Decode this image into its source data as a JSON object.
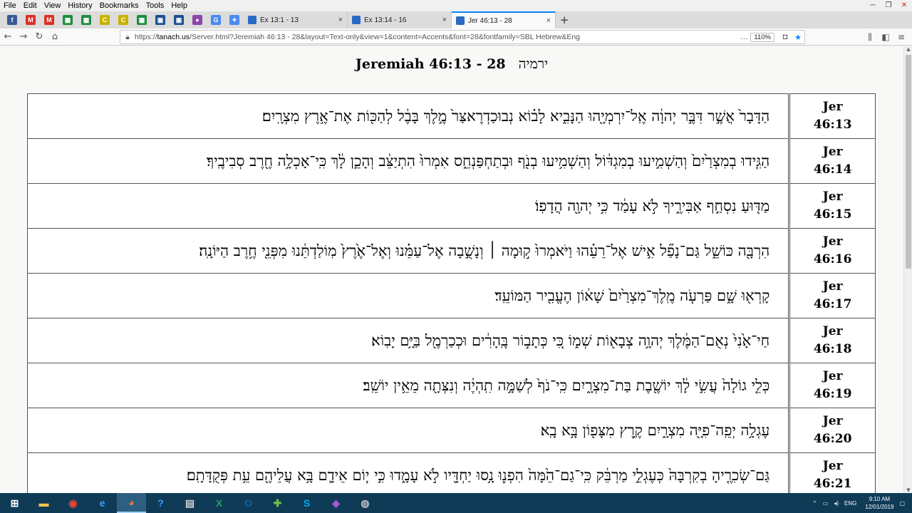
{
  "menu": [
    "File",
    "Edit",
    "View",
    "History",
    "Bookmarks",
    "Tools",
    "Help"
  ],
  "pinned": [
    {
      "name": "facebook-icon",
      "glyph": "f",
      "color": "#3b5998"
    },
    {
      "name": "gmail-icon",
      "glyph": "M",
      "color": "#d93025"
    },
    {
      "name": "gmail-icon-2",
      "glyph": "M",
      "color": "#d93025"
    },
    {
      "name": "sheets-icon",
      "glyph": "▦",
      "color": "#1e8e3e"
    },
    {
      "name": "sheets-icon-2",
      "glyph": "▦",
      "color": "#1e8e3e"
    },
    {
      "name": "yellow-app-icon",
      "glyph": "C",
      "color": "#c9b200"
    },
    {
      "name": "yellow-app-icon-2",
      "glyph": "C",
      "color": "#c9b200"
    },
    {
      "name": "sheets-icon-3",
      "glyph": "▦",
      "color": "#1e8e3e"
    },
    {
      "name": "save-icon",
      "glyph": "▣",
      "color": "#1d4f91"
    },
    {
      "name": "save-icon-2",
      "glyph": "▣",
      "color": "#1d4f91"
    },
    {
      "name": "circle-app-icon",
      "glyph": "●",
      "color": "#8e44ad"
    },
    {
      "name": "translate-icon",
      "glyph": "G",
      "color": "#4a8af4"
    },
    {
      "name": "settings-link-icon",
      "glyph": "✦",
      "color": "#4a8af4"
    }
  ],
  "tabs": [
    {
      "label": "Ex 13:1 - 13",
      "close": "×"
    },
    {
      "label": "Ex 13:14 - 16",
      "close": "×"
    },
    {
      "label": "Jer 46:13 - 28",
      "close": "×"
    }
  ],
  "newtab": "+",
  "url": {
    "prefix": "https://",
    "host": "tanach.us",
    "path": "/Server.html?Jeremiah 46:13 - 28&layout=Text-only&view=1&content=Accents&font=28&fontfamily=SBL Hebrew&Eng",
    "zoom": "110%"
  },
  "page": {
    "title": "Jeremiah  46:13 - 28",
    "title_hebrew": "ירמיה"
  },
  "verses": [
    {
      "book": "Jer",
      "ref": "46:13",
      "text": "הַדָּבָר֙ אֲשֶׁ֣ר דִּבֶּ֣ר יְהוָ֔ה אֶֽל־יִרְמְיָ֖הוּ הַנָּבִ֑יא לָב֗וֹא נְבוּכַדְרֶאצַּר֙ מֶ֣לֶךְ בָּבֶ֔ל לְהַכּ֖וֹת אֶת־אֶ֥רֶץ מִצְרָֽיִם׃"
    },
    {
      "book": "Jer",
      "ref": "46:14",
      "text": "הַגִּ֤ידוּ בְמִצְרַ֙יִם֙ וְהַשְׁמִ֣יעוּ בְמִגְדּ֔וֹל וְהַשְׁמִ֥יעוּ בְנֹ֖ף וּבְתַחְפַּנְחֵ֑ס אִמְרוּ֙ הִתְיַצֵּ֔ב וְהָכֵ֣ן לָ֔ךְ כִּֽי־אָכְלָ֥ה חֶ֖רֶב סְבִיבֶֽיךָ׃"
    },
    {
      "book": "Jer",
      "ref": "46:15",
      "text": "מַדּ֖וּעַ נִסְחַ֣ף אַבִּירֶ֑יךָ לֹ֣א עָמַ֔ד כִּ֥י יְהוָ֖ה הֲדָפֽוֹ׃"
    },
    {
      "book": "Jer",
      "ref": "46:16",
      "text": "הִרְבָּ֖ה כּוֹשֵׁ֑ל גַּם־נָפַ֞ל אִ֣ישׁ אֶל־רֵעֵ֗הוּ וַיֹּאמְרוּ֙ ק֣וּמָה ׀ וְנָשֻׁ֣בָה אֶל־עַמֵּ֗נוּ וְאֶל־אֶ֙רֶץ֙ מֽוֹלַדְתֵּ֔נוּ מִפְּנֵ֖י חֶ֥רֶב הַיּוֹנָֽה׃"
    },
    {
      "book": "Jer",
      "ref": "46:17",
      "text": "קָרְא֖וּ שָׁ֑ם פַּרְעֹ֤ה מֶֽלֶךְ־מִצְרַ֙יִם֙ שָׁא֔וֹן הֶעֱבִ֖יר הַמּוֹעֵֽד׃"
    },
    {
      "book": "Jer",
      "ref": "46:18",
      "text": "חַי־אָ֙נִי֙ נְאֻם־הַמֶּ֔לֶךְ יְהוָ֥ה צְבָא֖וֹת שְׁמ֑וֹ כִּ֚י כְּתָב֣וֹר בֶּֽהָרִ֔ים וּכְכַרְמֶ֖ל בַּיָּ֥ם יָבֽוֹא׃"
    },
    {
      "book": "Jer",
      "ref": "46:19",
      "text": "כְּלֵ֤י גוֹלָה֙ עֲשִׂ֣י לָ֔ךְ יוֹשֶׁ֖בֶת בַּת־מִצְרָ֑יִם כִּֽי־נֹף֙ לְשַׁמָּ֣ה תִֽהְיֶ֔ה וְנִצְּתָ֖ה מֵאֵ֥ין יוֹשֵֽׁב׃"
    },
    {
      "book": "Jer",
      "ref": "46:20",
      "text": "עֶגְלָ֥ה יְפֵֽה־פִיָּ֖ה מִצְרָ֑יִם קֶ֥רֶץ מִצָּפ֖וֹן בָּ֥א בָֽא׃"
    },
    {
      "book": "Jer",
      "ref": "46:21",
      "text": "גַּם־שְׂכִרֶ֤יהָ בְקִרְבָּהּ֙ כְּעֶגְלֵ֣י מַרְבֵּ֔ק כִּֽי־גַם־הֵ֙מָּה֙ הִפְנ֛וּ נָ֥סוּ יַחְדָּ֖יו לֹ֣א עָמָ֑דוּ כִּ֣י י֧וֹם אֵידָ֛ם בָּ֥א עֲלֵיהֶ֖ם עֵ֥ת פְּקֻדָּתָֽם׃"
    }
  ],
  "taskbar": [
    {
      "name": "windows-start-icon",
      "glyph": "⊞",
      "color": "#ffffff"
    },
    {
      "name": "file-explorer-icon",
      "glyph": "▬",
      "color": "#f3c44a"
    },
    {
      "name": "chrome-icon",
      "glyph": "◉",
      "color": "#ea4335"
    },
    {
      "name": "edge-icon",
      "glyph": "e",
      "color": "#3aa0ff"
    },
    {
      "name": "firefox-icon",
      "glyph": "◕",
      "color": "#ff7139"
    },
    {
      "name": "help-app-icon",
      "glyph": "?",
      "color": "#3aa0ff"
    },
    {
      "name": "calculator-icon",
      "glyph": "▤",
      "color": "#cccccc"
    },
    {
      "name": "excel-icon",
      "glyph": "X",
      "color": "#21a366"
    },
    {
      "name": "outlook-icon",
      "glyph": "O",
      "color": "#0a64ad"
    },
    {
      "name": "green-app-icon",
      "glyph": "✚",
      "color": "#6cc04a"
    },
    {
      "name": "skype-icon",
      "glyph": "S",
      "color": "#00aff0"
    },
    {
      "name": "purple-app-icon",
      "glyph": "◆",
      "color": "#a35bd1"
    },
    {
      "name": "dark-app-icon",
      "glyph": "◍",
      "color": "#bbbbbb"
    }
  ],
  "tray": {
    "lang": "ENG",
    "time": "9:10 AM",
    "date": "12/01/2019"
  }
}
